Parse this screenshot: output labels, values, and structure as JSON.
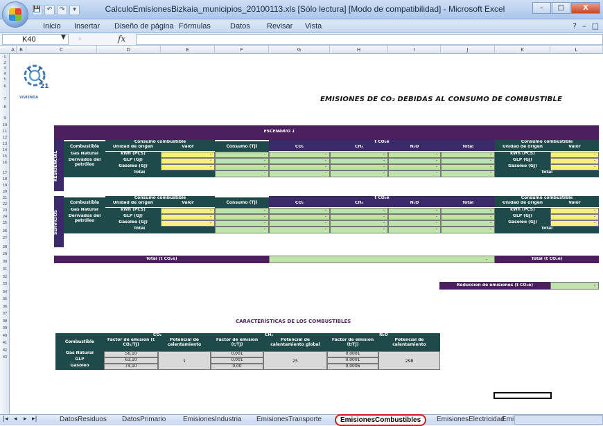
{
  "window": {
    "title": "CalculoEmisionesBizkaia_municipios_20100113.xls  [Sólo lectura]  [Modo de compatibilidad] - Microsoft Excel",
    "controls": [
      "–",
      "□",
      "X"
    ]
  },
  "quick_access": [
    "💾",
    "↶",
    "↷",
    "▾"
  ],
  "ribbon": {
    "tabs": [
      "Inicio",
      "Insertar",
      "Diseño de página",
      "Fórmulas",
      "Datos",
      "Revisar",
      "Vista"
    ],
    "right_controls": [
      "?",
      "–",
      "□"
    ]
  },
  "formula_bar": {
    "name_box": "K40",
    "fx": "fx",
    "value": ""
  },
  "columns": [
    "A",
    "B",
    "C",
    "D",
    "E",
    "F",
    "G",
    "H",
    "I",
    "J",
    "K",
    "L"
  ],
  "rows": [
    "1",
    "2",
    "3",
    "4",
    "5",
    "6",
    "7",
    "8",
    "9",
    "10",
    "11",
    "12",
    "13",
    "14",
    "15",
    "16",
    "17",
    "18",
    "19",
    "20",
    "21",
    "22",
    "23",
    "24",
    "25",
    "26",
    "27",
    "28",
    "29",
    "30",
    "31",
    "32",
    "33",
    "34",
    "35",
    "36",
    "37",
    "38",
    "39",
    "40",
    "41",
    "42",
    "43"
  ],
  "sheet": {
    "logo_text": "VIVIENDA",
    "logo_num": "21",
    "title": "EMISIONES DE CO₂ DEBIDAS AL CONSUMO DE COMBUSTIBLE",
    "escenario": "ESCENARIO 1",
    "headers": {
      "combustible": "Combustible",
      "consumo_combustible": "Consumo combustible",
      "unidad_origen": "Unidad de origen",
      "valor": "Valor",
      "consumo_tj": "Consumo (TJ)",
      "t_co2e": "t CO₂e",
      "co2": "CO₂",
      "ch4": "CH₄",
      "n2o": "N₂O",
      "total": "Total"
    },
    "residencial": {
      "side_label": "RESIDENCIAL",
      "fuels": [
        "Gas Natural",
        "Derivados del petróleo"
      ],
      "units": [
        "kWh (PCS)",
        "GLP (GJ)",
        "Gasóleo (GJ)"
      ],
      "total_label": "Total",
      "dash": "-"
    },
    "servicios": {
      "side_label": "SERVICIOS",
      "fuels": [
        "Gas Natural",
        "Derivados del petróleo"
      ],
      "units": [
        "kWh (PCS)",
        "GLP (GJ)",
        "Gasóleo (GJ)"
      ],
      "total_label": "Total",
      "dash": "-"
    },
    "total_row_label": "Total (t CO₂e)",
    "total_row_value": "-",
    "total_right_label": "Total (t CO₂e)",
    "reduccion_label": "Reducción de emisiones (t CO₂e)",
    "reduccion_value": "-",
    "caracteristicas": {
      "title": "CARACTERÍSTICAS DE LOS COMBUSTIBLES",
      "group_headers": [
        "CO₂",
        "CH₄",
        "N₂O"
      ],
      "col_headers": [
        "Combustible",
        "Factor de emisión (t CO₂/TJ)",
        "Potencial de calentamiento",
        "Factor de emisión (t/TJ)",
        "Potencial de calentamiento global",
        "Factor de emisión (t/TJ)",
        "Potencial de calentamiento"
      ],
      "rows": [
        {
          "fuel": "Gas Natural",
          "co2": "56,10",
          "ch4": "0,001",
          "n2o": "0,0001"
        },
        {
          "fuel": "GLP",
          "co2": "63,10",
          "ch4": "0,001",
          "n2o": "0,0001"
        },
        {
          "fuel": "Gasóleo",
          "co2": "74,10",
          "ch4": "0,00",
          "n2o": "0,0006"
        }
      ],
      "pot_co2": "1",
      "pot_ch4": "25",
      "pot_n2o": "298"
    }
  },
  "sheet_tabs": {
    "nav": [
      "|◂",
      "◂",
      "▸",
      "▸|"
    ],
    "tabs": [
      "DatosResiduos",
      "DatosPrimario",
      "EmisionesIndustria",
      "EmisionesTransporte",
      "EmisionesCombustibles",
      "EmisionesElectricidad",
      "Emi"
    ],
    "active": "EmisionesCombustibles"
  }
}
